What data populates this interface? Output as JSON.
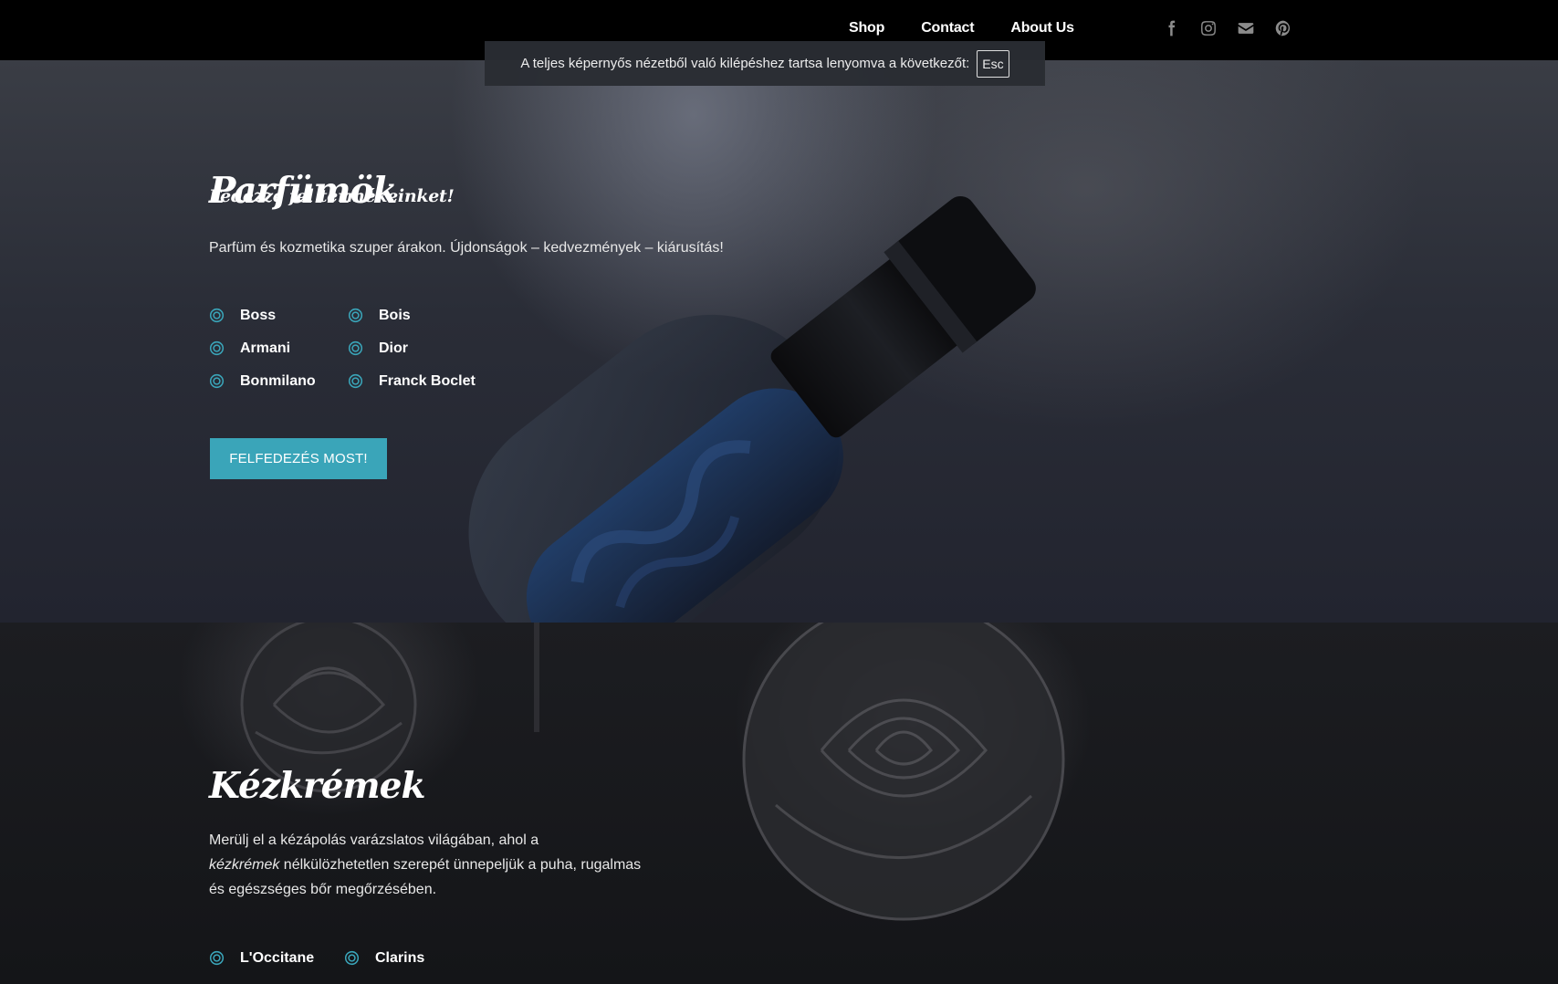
{
  "nav": {
    "shop": "Shop",
    "contact": "Contact",
    "about": "About Us"
  },
  "social": [
    "facebook-icon",
    "instagram-icon",
    "email-icon",
    "pinterest-icon"
  ],
  "fullscreen_notice": {
    "text": "A teljes képernyős nézetből való kilépéshez tartsa lenyomva a következőt:",
    "key": "Esc"
  },
  "hero_perfume": {
    "kicker": "Fedezze fel termékeinket!",
    "title": "Parfümök",
    "description": "Parfüm és kozmetika szuper árakon. Újdonságok – kedvezmények – kiárusítás!",
    "brands": [
      "Boss",
      "Bois",
      "Armani",
      "Dior",
      "Bonmilano",
      "Franck Boclet"
    ],
    "button": "FELFEDEZÉS MOST!"
  },
  "hero_cream": {
    "title": "Kézkrémek",
    "description_1": "Merülj el a kézápolás varázslatos világában, ahol a",
    "description_em": "kézkrémek",
    "description_2": " nélkülözhetetlen szerepét ünnepeljük a puha, rugalmas és egészséges bőr megőrzésében.",
    "brands": [
      "L'Occitane",
      "Clarins"
    ]
  },
  "colors": {
    "accent": "#3aa5b9",
    "topbar": "#000000"
  }
}
